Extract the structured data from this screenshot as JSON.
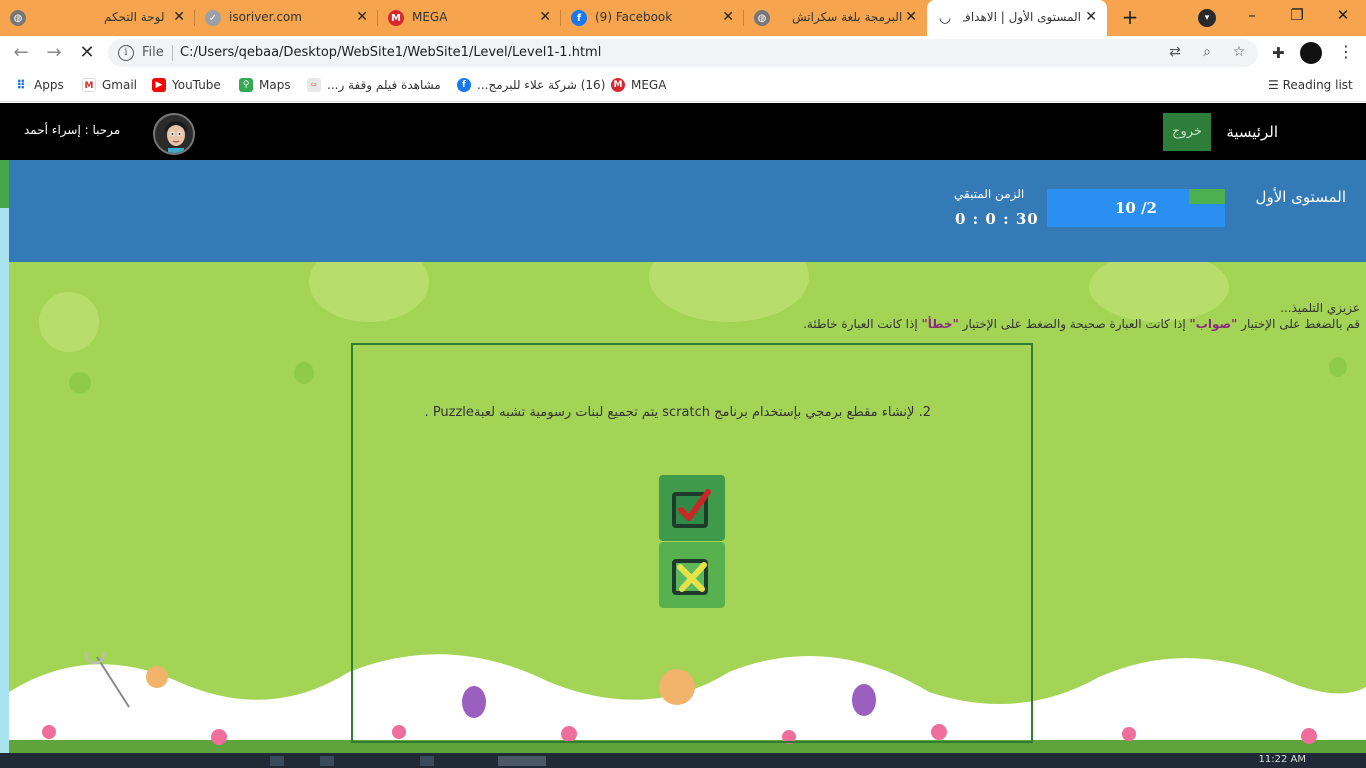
{
  "browser": {
    "tabs": [
      {
        "title": "لوحة التحكم",
        "icon": "globe-icon",
        "active": false
      },
      {
        "title": "isoriver.com",
        "icon": "check-circle-icon",
        "active": false
      },
      {
        "title": "MEGA",
        "icon": "mega-icon",
        "active": false
      },
      {
        "title": "(9) Facebook",
        "icon": "facebook-icon",
        "active": false
      },
      {
        "title": "البرمجة بلغة سكراتش",
        "icon": "globe-icon",
        "active": false
      },
      {
        "title": "المستوى الأول | الاهداف",
        "icon": "loading-spinner-icon",
        "active": true
      }
    ],
    "new_tab": "+",
    "window_controls": {
      "minimize": "–",
      "restore": "❐",
      "close": "✕"
    },
    "address": {
      "scheme_label": "File",
      "url": "C:/Users/qebaa/Desktop/WebSite1/WebSite1/Level/Level1-1.html"
    },
    "bookmarks": [
      {
        "label": "Apps",
        "icon": "apps-grid-icon"
      },
      {
        "label": "Gmail",
        "icon": "gmail-icon"
      },
      {
        "label": "YouTube",
        "icon": "youtube-icon"
      },
      {
        "label": "Maps",
        "icon": "maps-icon"
      },
      {
        "label": "مشاهدة فيلم وقفة ر...",
        "icon": "site-icon"
      },
      {
        "label": "(16) شركة علاء للبرمج...",
        "icon": "facebook-icon"
      },
      {
        "label": "MEGA",
        "icon": "mega-icon"
      }
    ],
    "reading_list": "Reading list",
    "colors": {
      "tab_strip": "#f6a54e"
    }
  },
  "site": {
    "nav": {
      "home": "الرئيسية",
      "logout": "خروج",
      "greeting": "مرحبا : إسراء أحمد"
    },
    "level": {
      "title": "المستوى الأول",
      "progress_text": "10 /2",
      "progress_current": 2,
      "progress_total": 10,
      "timer_label": "الزمن المتبقي",
      "timer_value": "0 : 0 : 30"
    },
    "instructions": {
      "greeting": "عزيزي التلميذ...",
      "part1": "قم بالضغط على الإختيار ",
      "true_word": "\"صواب\"",
      "part2": " إذا كانت العبارة صحيحة والضغط على الإختيار ",
      "false_word": "\"خطأ\"",
      "part3": " إذا كانت العبارة خاطئة."
    },
    "question": {
      "text": "2. لإنشاء مقطع برمجي بإستخدام برنامج scratch يتم تجميع لبنات رسومية تشبه لعبةPuzzle ."
    },
    "answers": {
      "true_icon": "checkbox-red-check-icon",
      "false_icon": "checkbox-yellow-x-icon"
    },
    "colors": {
      "header": "#337ab7",
      "content": "#a4d456",
      "logout": "#2f7d3a",
      "progress": "#2a8ff0",
      "progress_fill": "#4caf50"
    }
  },
  "taskbar": {
    "clock": "11:22 AM"
  }
}
